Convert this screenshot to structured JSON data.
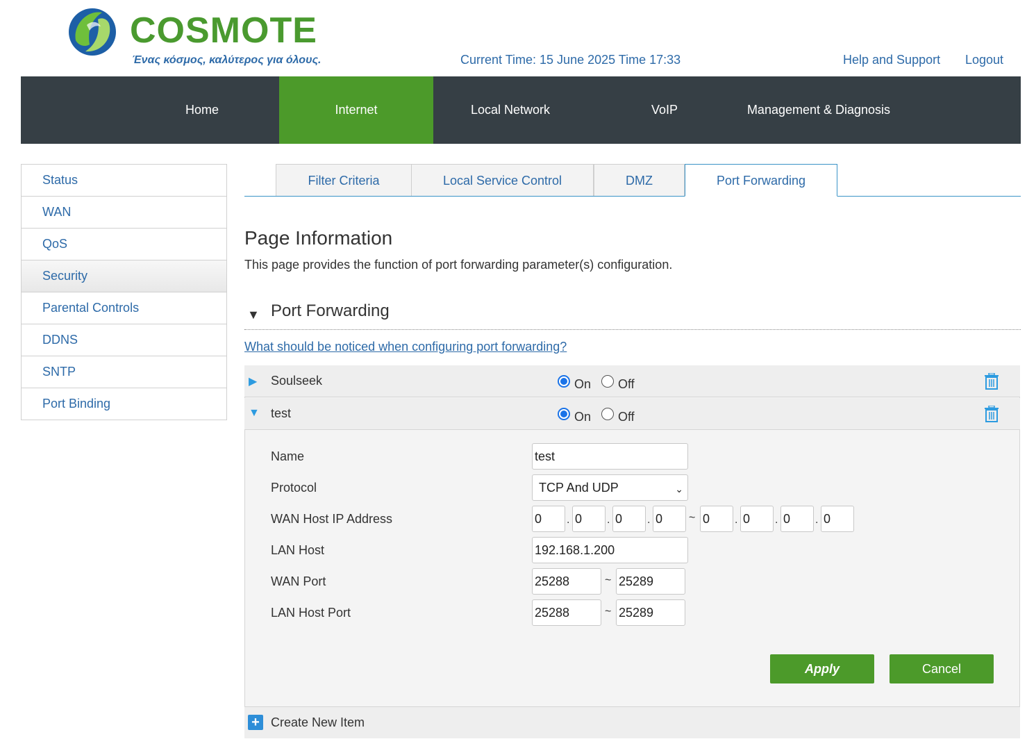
{
  "header": {
    "brand": "COSMOTE",
    "slogan": "Ένας κόσμος, καλύτερος για όλους.",
    "current_time": "Current Time: 15 June 2025 Time 17:33",
    "help_link": "Help and Support",
    "logout_link": "Logout"
  },
  "nav": {
    "items": [
      {
        "label": "Home"
      },
      {
        "label": "Internet"
      },
      {
        "label": "Local Network"
      },
      {
        "label": "VoIP"
      },
      {
        "label": "Management & Diagnosis"
      }
    ],
    "active": "Internet"
  },
  "sidebar": {
    "items": [
      {
        "label": "Status"
      },
      {
        "label": "WAN"
      },
      {
        "label": "QoS"
      },
      {
        "label": "Security"
      },
      {
        "label": "Parental Controls"
      },
      {
        "label": "DDNS"
      },
      {
        "label": "SNTP"
      },
      {
        "label": "Port Binding"
      }
    ],
    "active": "Security"
  },
  "tabs": {
    "items": [
      {
        "label": "Filter Criteria"
      },
      {
        "label": "Local Service Control"
      },
      {
        "label": "DMZ"
      },
      {
        "label": "Port Forwarding"
      }
    ],
    "active": "Port Forwarding"
  },
  "page": {
    "title": "Page Information",
    "description": "This page provides the function of port forwarding parameter(s) configuration.",
    "section_title": "Port Forwarding",
    "notice_link": "What should be noticed when configuring port forwarding?"
  },
  "rules": [
    {
      "name": "Soulseek",
      "expanded": false,
      "state": "On",
      "on_label": "On",
      "off_label": "Off"
    },
    {
      "name": "test",
      "expanded": true,
      "state": "On",
      "on_label": "On",
      "off_label": "Off"
    }
  ],
  "form": {
    "name_label": "Name",
    "name_value": "test",
    "protocol_label": "Protocol",
    "protocol_value": "TCP And UDP",
    "wan_ip_label": "WAN Host IP Address",
    "wan_ip_start": [
      "0",
      "0",
      "0",
      "0"
    ],
    "wan_ip_end": [
      "0",
      "0",
      "0",
      "0"
    ],
    "lan_host_label": "LAN Host",
    "lan_host_value": "192.168.1.200",
    "wan_port_label": "WAN Port",
    "wan_port_start": "25288",
    "wan_port_end": "25289",
    "lan_port_label": "LAN Host Port",
    "lan_port_start": "25288",
    "lan_port_end": "25289",
    "dot": ".",
    "tilde": "~"
  },
  "buttons": {
    "apply": "Apply",
    "cancel": "Cancel"
  },
  "create_item_label": "Create New Item",
  "colors": {
    "brand_green": "#4c9a2a",
    "nav_dark": "#363f45",
    "link_blue": "#2d6aa8",
    "accent_blue": "#2d9be0"
  }
}
